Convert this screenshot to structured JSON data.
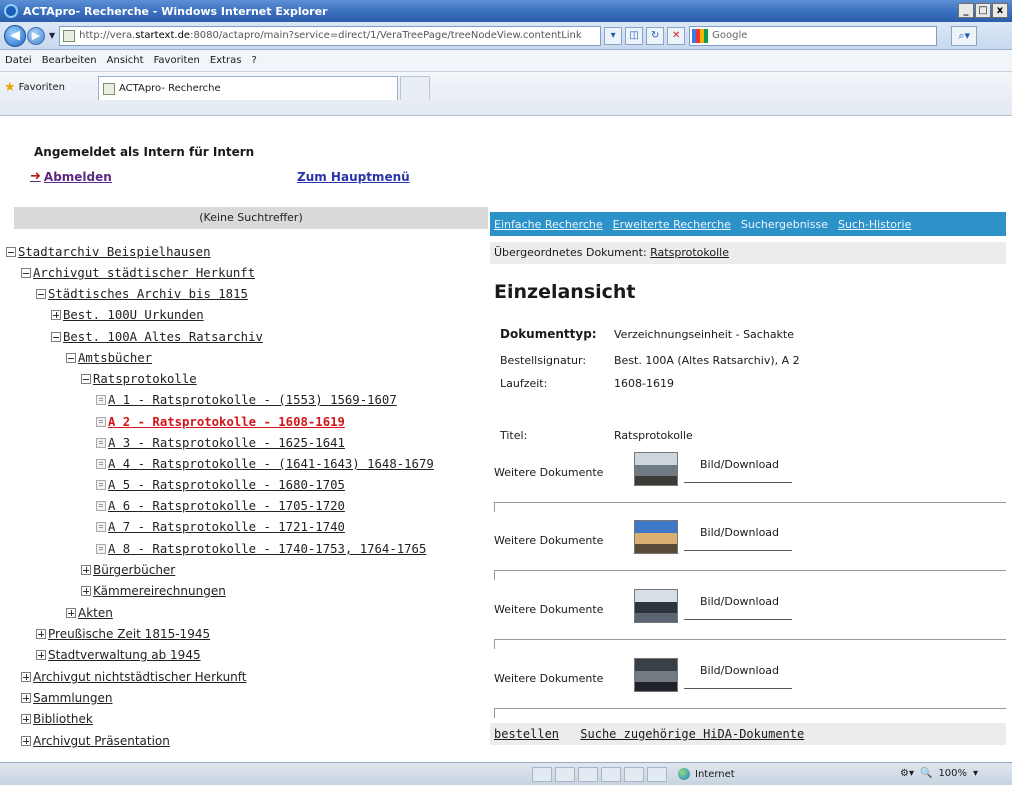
{
  "window": {
    "title": "ACTApro- Recherche - Windows Internet Explorer"
  },
  "browser": {
    "url_prefix": "http://vera.",
    "url_host": "startext.de",
    "url_rest": ":8080/actapro/main?service=direct/1/VeraTreePage/treeNodeView.contentLink",
    "search_engine": "Google",
    "menu": [
      "Datei",
      "Bearbeiten",
      "Ansicht",
      "Favoriten",
      "Extras",
      "?"
    ],
    "favorites_label": "Favoriten",
    "tab_title": "ACTApro- Recherche"
  },
  "header": {
    "login_status": "Angemeldet als Intern  für  Intern",
    "logout_label": "Abmelden",
    "mainmenu_label": "Zum Hauptmenü"
  },
  "left": {
    "search_hits": "(Keine Suchtreffer)",
    "tree": [
      {
        "label": "Stadtarchiv Beispielhausen",
        "toggle": "minus",
        "level": 0,
        "sans": false
      },
      {
        "label": "Archivgut städtischer Herkunft",
        "toggle": "minus",
        "level": 1,
        "sans": false
      },
      {
        "label": "Städtisches Archiv bis 1815",
        "toggle": "minus",
        "level": 2,
        "sans": false
      },
      {
        "label": "Best. 100U Urkunden",
        "toggle": "plus",
        "level": 3,
        "sans": false
      },
      {
        "label": "Best. 100A Altes Ratsarchiv",
        "toggle": "minus",
        "level": 3,
        "sans": false
      },
      {
        "label": "Amtsbücher",
        "toggle": "minus",
        "level": 4,
        "sans": false
      },
      {
        "label": "Ratsprotokolle",
        "toggle": "minus",
        "level": 5,
        "sans": false
      },
      {
        "label": "A 1 - Ratsprotokolle - (1553) 1569-1607",
        "toggle": "leaf",
        "level": 6,
        "sans": false
      },
      {
        "label": "A 2 - Ratsprotokolle - 1608-1619",
        "toggle": "leaf",
        "level": 6,
        "sans": false,
        "active": true
      },
      {
        "label": "A 3 - Ratsprotokolle - 1625-1641",
        "toggle": "leaf",
        "level": 6,
        "sans": false
      },
      {
        "label": "A 4 - Ratsprotokolle - (1641-1643) 1648-1679",
        "toggle": "leaf",
        "level": 6,
        "sans": false
      },
      {
        "label": "A 5 - Ratsprotokolle - 1680-1705",
        "toggle": "leaf",
        "level": 6,
        "sans": false
      },
      {
        "label": "A 6 - Ratsprotokolle - 1705-1720",
        "toggle": "leaf",
        "level": 6,
        "sans": false
      },
      {
        "label": "A 7 - Ratsprotokolle - 1721-1740",
        "toggle": "leaf",
        "level": 6,
        "sans": false
      },
      {
        "label": "A 8 - Ratsprotokolle - 1740-1753, 1764-1765",
        "toggle": "leaf",
        "level": 6,
        "sans": false
      },
      {
        "label": "Bürgerbücher",
        "toggle": "plus",
        "level": 5,
        "sans": true
      },
      {
        "label": "Kämmereirechnungen",
        "toggle": "plus",
        "level": 5,
        "sans": true
      },
      {
        "label": "Akten",
        "toggle": "plus",
        "level": 4,
        "sans": true
      },
      {
        "label": "Preußische Zeit 1815-1945",
        "toggle": "plus",
        "level": 2,
        "sans": true
      },
      {
        "label": "Stadtverwaltung ab 1945",
        "toggle": "plus",
        "level": 2,
        "sans": true
      },
      {
        "label": "Archivgut nichtstädtischer Herkunft",
        "toggle": "plus",
        "level": 1,
        "sans": true
      },
      {
        "label": "Sammlungen",
        "toggle": "plus",
        "level": 1,
        "sans": true
      },
      {
        "label": "Bibliothek",
        "toggle": "plus",
        "level": 1,
        "sans": true
      },
      {
        "label": "Archivgut Präsentation",
        "toggle": "plus",
        "level": 1,
        "sans": true
      }
    ]
  },
  "right": {
    "tabs": [
      {
        "label": "Einfache Recherche",
        "link": true
      },
      {
        "label": "Erweiterte Recherche",
        "link": true
      },
      {
        "label": "Suchergebnisse",
        "link": false
      },
      {
        "label": "Such-Historie",
        "link": true
      }
    ],
    "parent_label": "Übergeordnetes Dokument:",
    "parent_link": "Ratsprotokolle",
    "detail_title": "Einzelansicht",
    "meta": [
      {
        "label": "Dokumenttyp:",
        "value": "Verzeichnungseinheit - Sachakte",
        "bold": true
      },
      {
        "label": "Bestellsignatur:",
        "value": "Best. 100A (Altes Ratsarchiv), A 2",
        "bold": false
      },
      {
        "label": "Laufzeit:",
        "value": "1608-1619",
        "bold": false
      },
      {
        "label": "Titel:",
        "value": "Ratsprotokolle",
        "bold": false
      }
    ],
    "documents": [
      {
        "label": "Weitere Dokumente",
        "link": "Bild/Download",
        "thumb_colors": [
          "#cfd6dc",
          "#6f7a83",
          "#3c3a36"
        ]
      },
      {
        "label": "Weitere Dokumente",
        "link": "Bild/Download",
        "thumb_colors": [
          "#3f78c8",
          "#d9b070",
          "#5a4a3a"
        ]
      },
      {
        "label": "Weitere Dokumente",
        "link": "Bild/Download",
        "thumb_colors": [
          "#d7dee6",
          "#2c3440",
          "#5b6470"
        ]
      },
      {
        "label": "Weitere Dokumente",
        "link": "Bild/Download",
        "thumb_colors": [
          "#3a4048",
          "#727a82",
          "#1f2328"
        ]
      }
    ],
    "bottom_links": [
      "bestellen",
      "Suche zugehörige HiDA-Dokumente"
    ]
  },
  "status": {
    "zone": "Internet",
    "zoom": "100%"
  }
}
